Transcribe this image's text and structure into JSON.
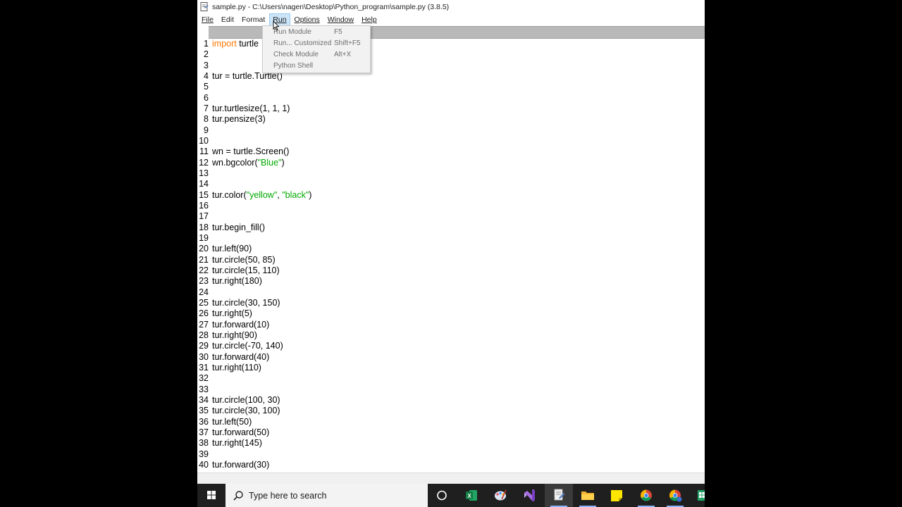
{
  "window": {
    "title": "sample.py - C:\\Users\\nagen\\Desktop\\Python_program\\sample.py (3.8.5)"
  },
  "menubar": {
    "items": [
      {
        "label": "File",
        "mnemonic": "F"
      },
      {
        "label": "Edit",
        "mnemonic": "E"
      },
      {
        "label": "Format",
        "mnemonic": "o"
      },
      {
        "label": "Run",
        "mnemonic": "R"
      },
      {
        "label": "Options",
        "mnemonic": "O"
      },
      {
        "label": "Window",
        "mnemonic": "W"
      },
      {
        "label": "Help",
        "mnemonic": "H"
      }
    ],
    "active": "Run"
  },
  "run_menu": {
    "items": [
      {
        "label": "Run Module",
        "accel": "F5"
      },
      {
        "label": "Run... Customized",
        "accel": "Shift+F5"
      },
      {
        "label": "Check Module",
        "accel": "Alt+X"
      },
      {
        "label": "Python Shell",
        "accel": ""
      }
    ]
  },
  "editor": {
    "lines": [
      {
        "n": "1",
        "tokens": [
          {
            "t": "import",
            "c": "kw"
          },
          {
            "t": " turtle",
            "c": ""
          }
        ]
      },
      {
        "n": "2",
        "tokens": []
      },
      {
        "n": "3",
        "tokens": []
      },
      {
        "n": "4",
        "tokens": [
          {
            "t": "tur = turtle.Turtle()",
            "c": ""
          }
        ]
      },
      {
        "n": "5",
        "tokens": []
      },
      {
        "n": "6",
        "tokens": []
      },
      {
        "n": "7",
        "tokens": [
          {
            "t": "tur.turtlesize(1, 1, 1)",
            "c": ""
          }
        ]
      },
      {
        "n": "8",
        "tokens": [
          {
            "t": "tur.pensize(3)",
            "c": ""
          }
        ]
      },
      {
        "n": "9",
        "tokens": []
      },
      {
        "n": "10",
        "tokens": []
      },
      {
        "n": "11",
        "tokens": [
          {
            "t": "wn = turtle.Screen()",
            "c": ""
          }
        ]
      },
      {
        "n": "12",
        "tokens": [
          {
            "t": "wn.bgcolor(",
            "c": ""
          },
          {
            "t": "\"Blue\"",
            "c": "str"
          },
          {
            "t": ")",
            "c": ""
          }
        ]
      },
      {
        "n": "13",
        "tokens": []
      },
      {
        "n": "14",
        "tokens": []
      },
      {
        "n": "15",
        "tokens": [
          {
            "t": "tur.color(",
            "c": ""
          },
          {
            "t": "\"yellow\"",
            "c": "str"
          },
          {
            "t": ", ",
            "c": ""
          },
          {
            "t": "\"black\"",
            "c": "str"
          },
          {
            "t": ")",
            "c": ""
          }
        ]
      },
      {
        "n": "16",
        "tokens": []
      },
      {
        "n": "17",
        "tokens": []
      },
      {
        "n": "18",
        "tokens": [
          {
            "t": "tur.begin_fill()",
            "c": ""
          }
        ]
      },
      {
        "n": "19",
        "tokens": []
      },
      {
        "n": "20",
        "tokens": [
          {
            "t": "tur.left(90)",
            "c": ""
          }
        ]
      },
      {
        "n": "21",
        "tokens": [
          {
            "t": "tur.circle(50, 85)",
            "c": ""
          }
        ]
      },
      {
        "n": "22",
        "tokens": [
          {
            "t": "tur.circle(15, 110)",
            "c": ""
          }
        ]
      },
      {
        "n": "23",
        "tokens": [
          {
            "t": "tur.right(180)",
            "c": ""
          }
        ]
      },
      {
        "n": "24",
        "tokens": []
      },
      {
        "n": "25",
        "tokens": [
          {
            "t": "tur.circle(30, 150)",
            "c": ""
          }
        ]
      },
      {
        "n": "26",
        "tokens": [
          {
            "t": "tur.right(5)",
            "c": ""
          }
        ]
      },
      {
        "n": "27",
        "tokens": [
          {
            "t": "tur.forward(10)",
            "c": ""
          }
        ]
      },
      {
        "n": "28",
        "tokens": [
          {
            "t": "tur.right(90)",
            "c": ""
          }
        ]
      },
      {
        "n": "29",
        "tokens": [
          {
            "t": "tur.circle(-70, 140)",
            "c": ""
          }
        ]
      },
      {
        "n": "30",
        "tokens": [
          {
            "t": "tur.forward(40)",
            "c": ""
          }
        ]
      },
      {
        "n": "31",
        "tokens": [
          {
            "t": "tur.right(110)",
            "c": ""
          }
        ]
      },
      {
        "n": "32",
        "tokens": []
      },
      {
        "n": "33",
        "tokens": []
      },
      {
        "n": "34",
        "tokens": [
          {
            "t": "tur.circle(100, 30)",
            "c": ""
          }
        ]
      },
      {
        "n": "35",
        "tokens": [
          {
            "t": "tur.circle(30, 100)",
            "c": ""
          }
        ]
      },
      {
        "n": "36",
        "tokens": [
          {
            "t": "tur.left(50)",
            "c": ""
          }
        ]
      },
      {
        "n": "37",
        "tokens": [
          {
            "t": "tur.forward(50)",
            "c": ""
          }
        ]
      },
      {
        "n": "38",
        "tokens": [
          {
            "t": "tur.right(145)",
            "c": ""
          }
        ]
      },
      {
        "n": "39",
        "tokens": []
      },
      {
        "n": "40",
        "tokens": [
          {
            "t": "tur.forward(30)",
            "c": ""
          }
        ]
      }
    ]
  },
  "taskbar": {
    "search_placeholder": "Type here to search",
    "pinned": [
      {
        "name": "cortana-icon"
      },
      {
        "name": "excel-icon"
      },
      {
        "name": "paint-icon"
      },
      {
        "name": "visual-studio-icon"
      },
      {
        "name": "idle-editor-icon"
      },
      {
        "name": "file-explorer-icon"
      },
      {
        "name": "sticky-notes-icon"
      },
      {
        "name": "chrome-icon"
      },
      {
        "name": "chrome-profile-icon"
      },
      {
        "name": "excel-green-icon"
      }
    ]
  },
  "colors": {
    "keyword": "#ff7700",
    "string": "#00aa00",
    "menu_active_bg": "#cce4f7",
    "taskbar_bg": "#1f1f1f"
  }
}
